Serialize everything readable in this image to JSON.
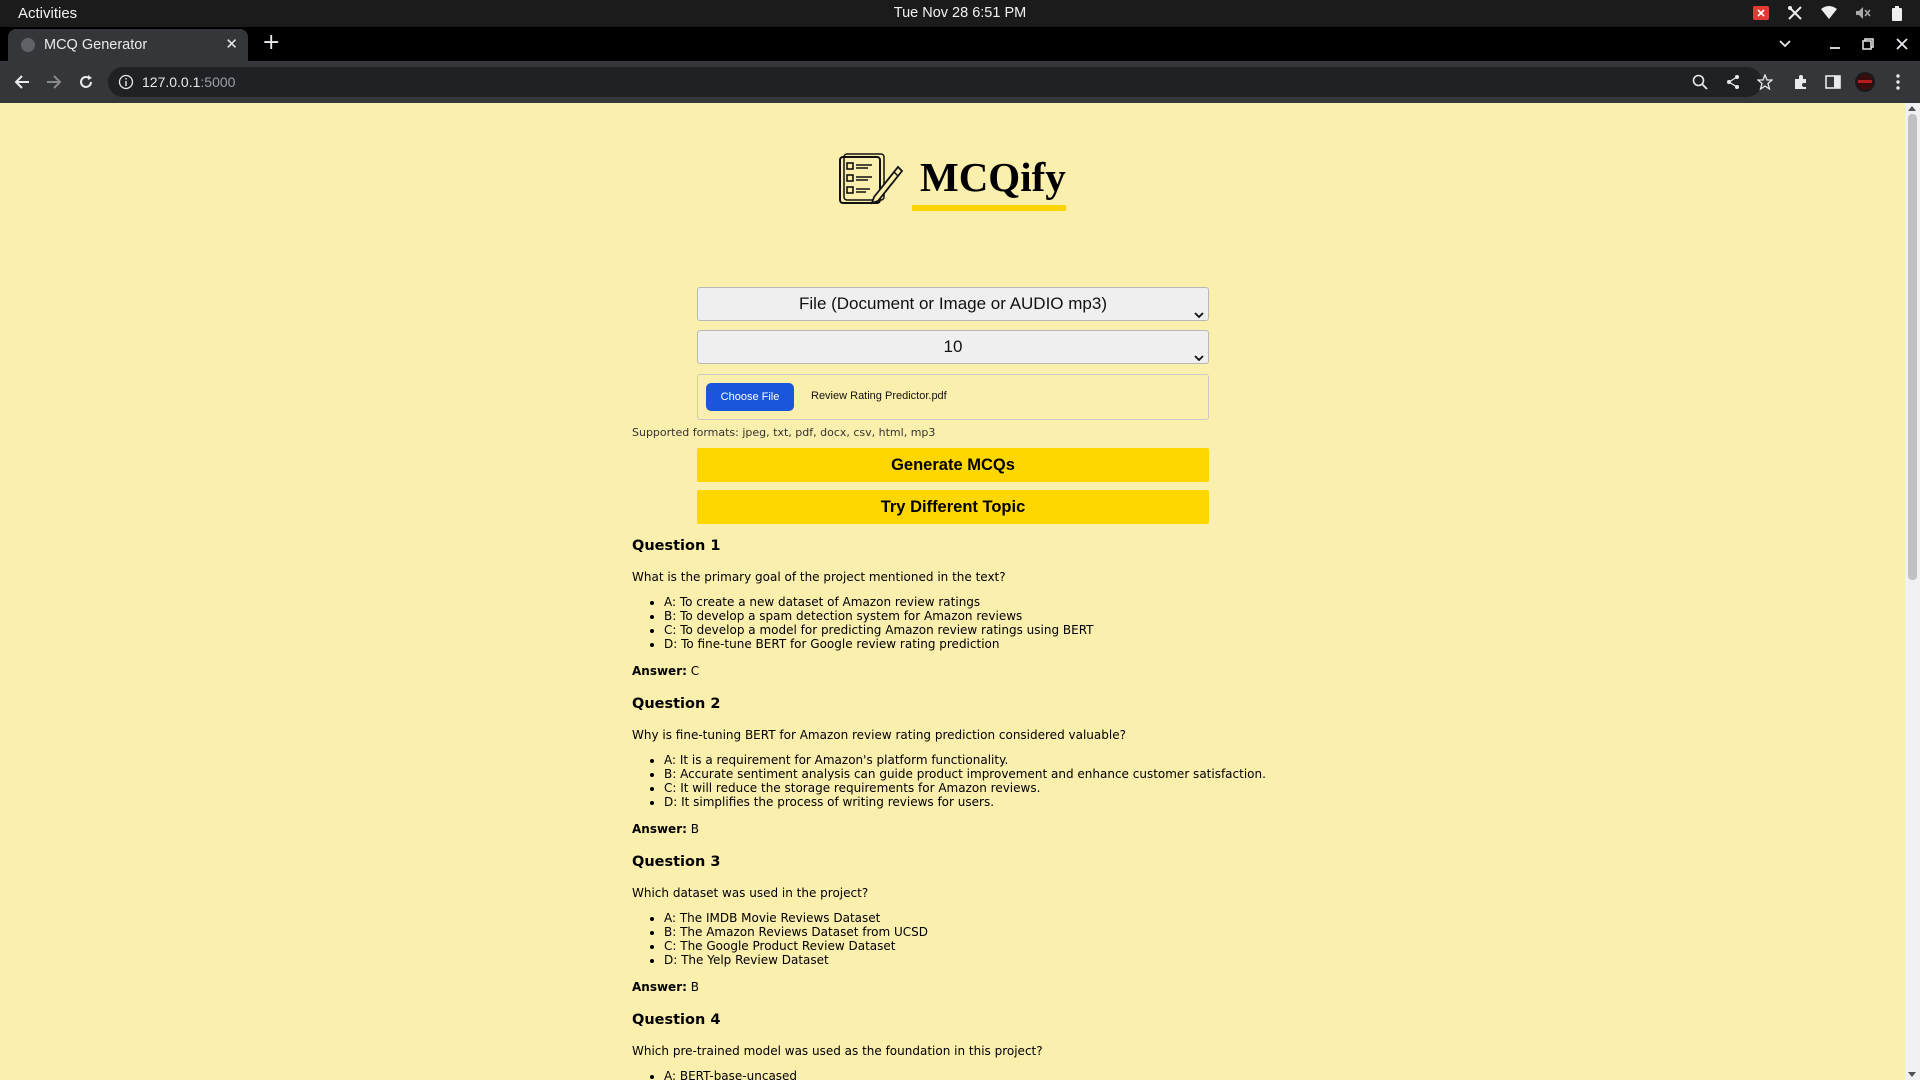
{
  "topbar": {
    "activities": "Activities",
    "clock": "Tue Nov 28   6:51 PM"
  },
  "browser": {
    "tab_title": "MCQ Generator",
    "url_host": "127.0.0.1",
    "url_port": ":5000"
  },
  "brand": {
    "name": "MCQify"
  },
  "controls": {
    "input_type": "File (Document or Image or AUDIO mp3)",
    "question_count": "10",
    "choose_file": "Choose File",
    "file_name": "Review Rating Predictor.pdf",
    "supported_formats": "Supported formats: jpeg, txt, pdf, docx, csv, html, mp3",
    "generate": "Generate MCQs",
    "try_different": "Try Different Topic"
  },
  "answer_label": "Answer:",
  "questions": [
    {
      "title": "Question 1",
      "text": "What is the primary goal of the project mentioned in the text?",
      "options": [
        "A: To create a new dataset of Amazon review ratings",
        "B: To develop a spam detection system for Amazon reviews",
        "C: To develop a model for predicting Amazon review ratings using BERT",
        "D: To fine-tune BERT for Google review rating prediction"
      ],
      "answer": "C"
    },
    {
      "title": "Question 2",
      "text": "Why is fine-tuning BERT for Amazon review rating prediction considered valuable?",
      "options": [
        "A: It is a requirement for Amazon's platform functionality.",
        "B: Accurate sentiment analysis can guide product improvement and enhance customer satisfaction.",
        "C: It will reduce the storage requirements for Amazon reviews.",
        "D: It simplifies the process of writing reviews for users."
      ],
      "answer": "B"
    },
    {
      "title": "Question 3",
      "text": "Which dataset was used in the project?",
      "options": [
        "A: The IMDB Movie Reviews Dataset",
        "B: The Amazon Reviews Dataset from UCSD",
        "C: The Google Product Review Dataset",
        "D: The Yelp Review Dataset"
      ],
      "answer": "B"
    },
    {
      "title": "Question 4",
      "text": "Which pre-trained model was used as the foundation in this project?",
      "options": [
        "A: BERT-base-uncased"
      ],
      "answer": ""
    }
  ],
  "colors": {
    "page_background": "#fbefae",
    "accent_yellow": "#ffd700",
    "choose_button": "#1a56db"
  }
}
